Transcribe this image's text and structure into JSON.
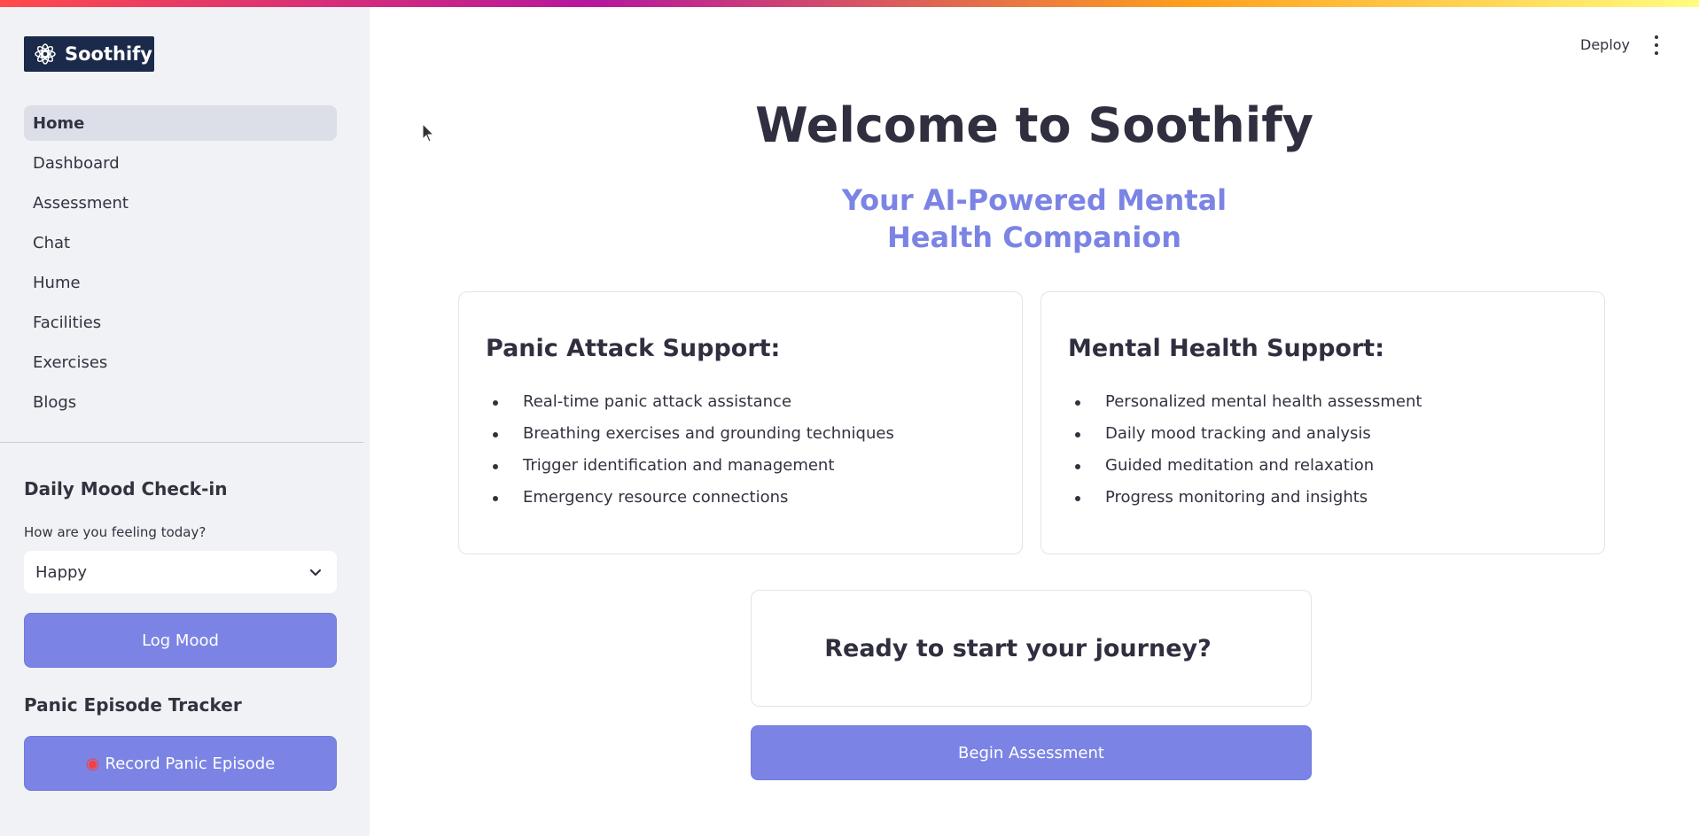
{
  "app": {
    "name": "Soothify"
  },
  "sidebar": {
    "nav": [
      {
        "label": "Home",
        "active": true
      },
      {
        "label": "Dashboard"
      },
      {
        "label": "Assessment"
      },
      {
        "label": "Chat"
      },
      {
        "label": "Hume"
      },
      {
        "label": "Facilities"
      },
      {
        "label": "Exercises"
      },
      {
        "label": "Blogs"
      }
    ],
    "mood": {
      "title": "Daily Mood Check-in",
      "question": "How are you feeling today?",
      "selected": "Happy",
      "button": "Log Mood"
    },
    "panic": {
      "title": "Panic Episode Tracker",
      "button": "Record Panic Episode",
      "icon": "siren-icon"
    }
  },
  "header": {
    "deploy": "Deploy"
  },
  "main": {
    "title": "Welcome to Soothify",
    "subtitle": "Your AI-Powered Mental Health Companion",
    "cards": [
      {
        "title": "Panic Attack Support:",
        "items": [
          "Real-time panic attack assistance",
          "Breathing exercises and grounding techniques",
          "Trigger identification and management",
          "Emergency resource connections"
        ]
      },
      {
        "title": "Mental Health Support:",
        "items": [
          "Personalized mental health assessment",
          "Daily mood tracking and analysis",
          "Guided meditation and relaxation",
          "Progress monitoring and insights"
        ]
      }
    ],
    "cta": {
      "heading": "Ready to start your journey?",
      "button": "Begin Assessment"
    }
  },
  "colors": {
    "accent": "#7b84e4",
    "sidebar_bg": "#f0f2f6",
    "logo_bg": "#1b2a4a"
  }
}
